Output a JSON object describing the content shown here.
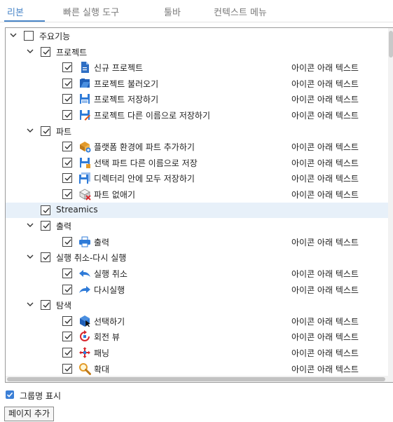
{
  "tabs": [
    {
      "label": "리본",
      "active": true
    },
    {
      "label": "빠른 실행 도구",
      "active": false
    },
    {
      "label": "툴바",
      "active": false
    },
    {
      "label": "컨텍스트 메뉴",
      "active": false
    }
  ],
  "tree": {
    "right_caption": "아이콘 아래 텍스트",
    "rows": [
      {
        "label": "주요기능",
        "level": 0,
        "checked": false,
        "expanded": true,
        "icon": "none"
      },
      {
        "label": "프로젝트",
        "level": 1,
        "checked": true,
        "expanded": true,
        "icon": "none"
      },
      {
        "label": "신규 프로젝트",
        "level": 2,
        "checked": true,
        "icon": "new-document-icon",
        "caption": true
      },
      {
        "label": "프로젝트 불러오기",
        "level": 2,
        "checked": true,
        "icon": "open-project-icon",
        "caption": true
      },
      {
        "label": "프로젝트 저장하기",
        "level": 2,
        "checked": true,
        "icon": "save-icon",
        "caption": true
      },
      {
        "label": "프로젝트 다른 이름으로 저장하기",
        "level": 2,
        "checked": true,
        "icon": "save-as-icon",
        "caption": true
      },
      {
        "label": "파트",
        "level": 1,
        "checked": true,
        "expanded": true,
        "icon": "none"
      },
      {
        "label": "플랫폼 환경에 파트 추가하기",
        "level": 2,
        "checked": true,
        "icon": "add-part-icon",
        "caption": true
      },
      {
        "label": "선택 파트 다른 이름으로 저장",
        "level": 2,
        "checked": true,
        "icon": "save-part-as-icon",
        "caption": true
      },
      {
        "label": "디렉터리 안에 모두 저장하기",
        "level": 2,
        "checked": true,
        "icon": "save-all-icon",
        "caption": true
      },
      {
        "label": "파트 없애기",
        "level": 2,
        "checked": true,
        "icon": "remove-part-icon",
        "caption": true
      },
      {
        "label": "Streamics",
        "level": 1,
        "checked": true,
        "expanded": null,
        "icon": "none",
        "highlight": true
      },
      {
        "label": "출력",
        "level": 1,
        "checked": true,
        "expanded": true,
        "icon": "none"
      },
      {
        "label": "출력",
        "level": 2,
        "checked": true,
        "icon": "print-icon",
        "caption": true
      },
      {
        "label": "실행 취소-다시 실행",
        "level": 1,
        "checked": true,
        "expanded": true,
        "icon": "none"
      },
      {
        "label": "실행 취소",
        "level": 2,
        "checked": true,
        "icon": "undo-icon",
        "caption": true
      },
      {
        "label": "다시실행",
        "level": 2,
        "checked": true,
        "icon": "redo-icon",
        "caption": true
      },
      {
        "label": "탐색",
        "level": 1,
        "checked": true,
        "expanded": true,
        "icon": "none"
      },
      {
        "label": "선택하기",
        "level": 2,
        "checked": true,
        "icon": "select-cube-icon",
        "caption": true
      },
      {
        "label": "회전 뷰",
        "level": 2,
        "checked": true,
        "icon": "rotate-view-icon",
        "caption": true
      },
      {
        "label": "패닝",
        "level": 2,
        "checked": true,
        "icon": "pan-icon",
        "caption": true
      },
      {
        "label": "확대",
        "level": 2,
        "checked": true,
        "icon": "zoom-icon",
        "caption": true
      }
    ]
  },
  "options": {
    "show_group_names": {
      "label": "그룹명 표시",
      "checked": true
    }
  },
  "buttons": {
    "add_page": "페이지 추가"
  },
  "colors": {
    "accent": "#4a86c8",
    "highlight_row": "#e7f0f9",
    "checkbox_blue": "#3b7fd6"
  }
}
